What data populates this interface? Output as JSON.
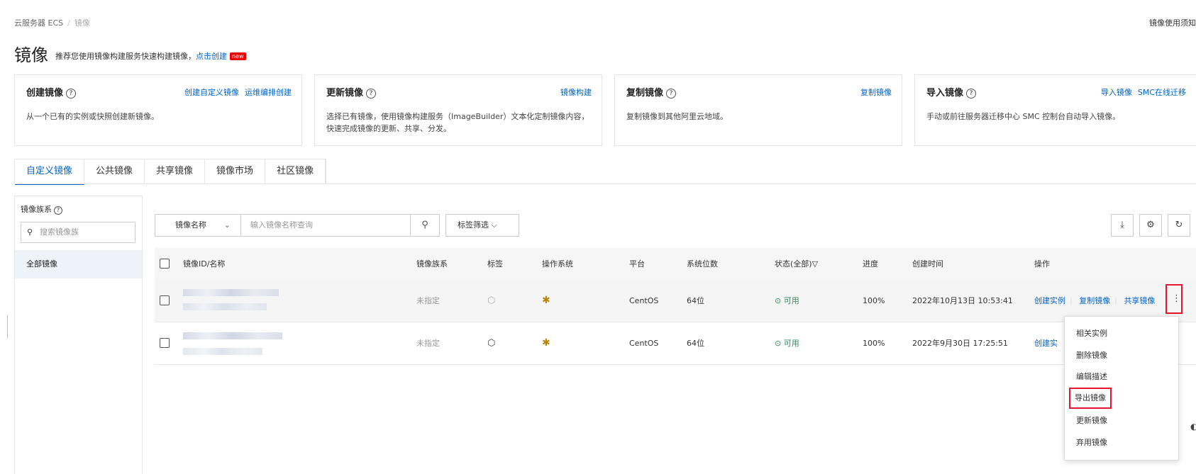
{
  "breadcrumb": [
    "云服务器 ECS",
    "镜像"
  ],
  "topright": "镜像使用须知",
  "header": {
    "title": "镜像",
    "subtitle": "推荐您使用镜像构建服务快速构建镜像，",
    "subtitle_link": "点击创建",
    "badge": "new"
  },
  "cards": [
    {
      "title": "创建镜像",
      "links": [
        "创建自定义镜像",
        "运维编排创建"
      ],
      "desc": "从一个已有的实例或快照创建新镜像。"
    },
    {
      "title": "更新镜像",
      "links": [
        "镜像构建"
      ],
      "desc": "选择已有镜像，使用镜像构建服务（ImageBuilder）文本化定制镜像内容，快速完成镜像的更新、共享、分发。"
    },
    {
      "title": "复制镜像",
      "links": [
        "复制镜像"
      ],
      "desc": "复制镜像到其他阿里云地域。"
    },
    {
      "title": "导入镜像",
      "links": [
        "导入镜像",
        "SMC在线迁移"
      ],
      "desc": "手动或前往服务器迁移中心 SMC 控制台自动导入镜像。"
    }
  ],
  "tabs": [
    "自定义镜像",
    "公共镜像",
    "共享镜像",
    "镜像市场",
    "社区镜像"
  ],
  "left_panel": {
    "title": "镜像族系",
    "search_placeholder": "搜索镜像族",
    "item": "全部镜像"
  },
  "toolbar": {
    "select_label": "镜像名称",
    "search_placeholder": "输入镜像名称查询",
    "tag_filter": "标签筛选"
  },
  "table": {
    "headers": [
      "镜像ID/名称",
      "镜像族系",
      "标签",
      "操作系统",
      "平台",
      "系统位数",
      "状态(全部)",
      "进度",
      "创建时间",
      "操作"
    ],
    "rows": [
      {
        "family": "未指定",
        "platform": "CentOS",
        "bits": "64位",
        "status": "可用",
        "progress": "100%",
        "created": "2022年10月13日 10:53:41",
        "ops": [
          "创建实例",
          "复制镜像",
          "共享镜像"
        ]
      },
      {
        "family": "未指定",
        "platform": "CentOS",
        "bits": "64位",
        "status": "可用",
        "progress": "100%",
        "created": "2022年9月30日 17:25:51",
        "ops": [
          "创建实"
        ]
      }
    ]
  },
  "menu": [
    "相关实例",
    "删除镜像",
    "编辑描述",
    "导出镜像",
    "更新镜像",
    "弃用镜像"
  ],
  "colors": {
    "accent": "#0064c8",
    "highlight": "#e5162d",
    "success": "#2e8b57"
  }
}
